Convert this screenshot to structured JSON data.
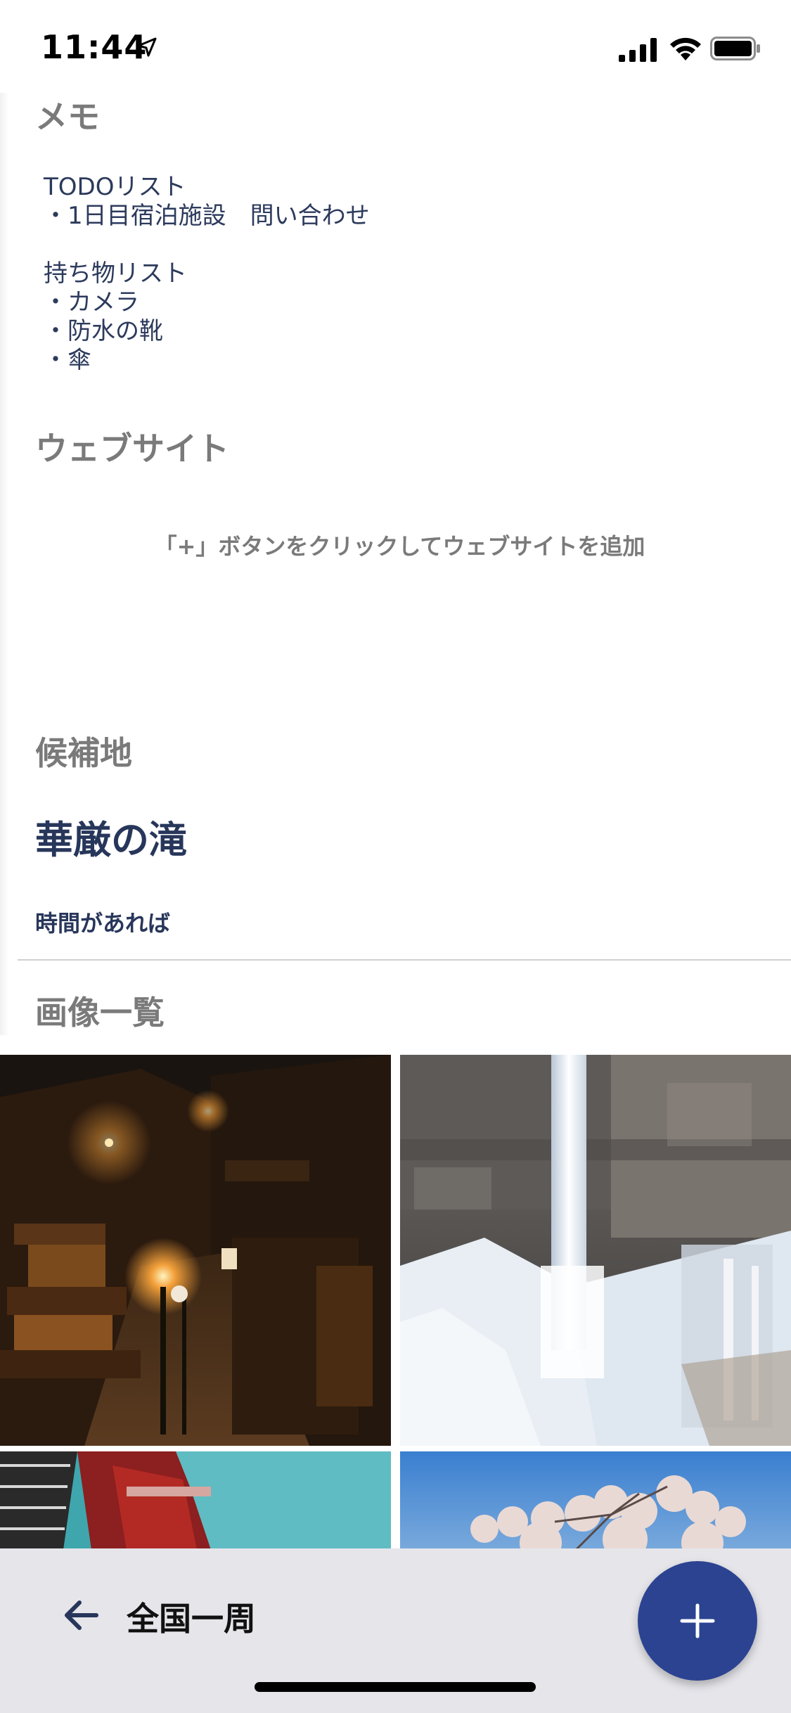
{
  "status_bar": {
    "time": "11:44"
  },
  "memo": {
    "heading": "メモ",
    "body": "TODOリスト\n・1日目宿泊施設　問い合わせ\n\n持ち物リスト\n・カメラ\n・防水の靴\n・傘"
  },
  "website": {
    "heading": "ウェブサイト",
    "empty_message": "「+」ボタンをクリックしてウェブサイトを追加"
  },
  "candidate": {
    "heading": "候補地",
    "name": "華厳の滝",
    "note": "時間があれば"
  },
  "images": {
    "heading": "画像一覧",
    "items": [
      "night-old-town-street-photo",
      "frozen-waterfall-photo",
      "red-bridge-river-photo",
      "blossom-tree-blue-sky-photo"
    ]
  },
  "bottom_bar": {
    "title": "全国一周",
    "back_icon": "arrow-left-icon",
    "add_icon": "plus-icon"
  },
  "colors": {
    "accent": "#2b4391",
    "heading_gray": "#7a7a7a",
    "text_navy": "#27365a",
    "bottom_bar_bg": "#e5e5ea"
  }
}
